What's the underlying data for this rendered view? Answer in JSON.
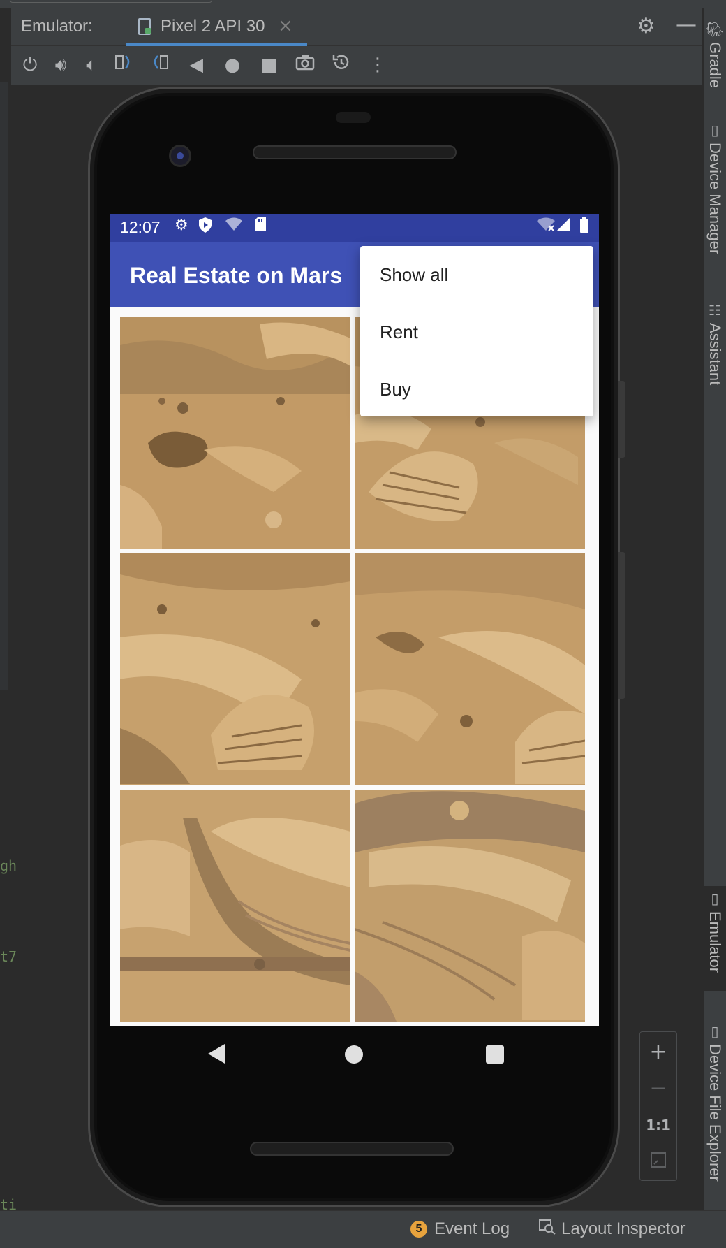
{
  "ide": {
    "emulator_label": "Emulator:",
    "device_tab": "Pixel 2 API 30",
    "tab_close": "×",
    "toolbar_icons": [
      "power-icon",
      "volume-up-icon",
      "volume-down-icon",
      "rotate-left-icon",
      "rotate-right-icon",
      "back-icon",
      "home-icon",
      "overview-icon",
      "screenshot-icon",
      "snapshot-icon",
      "more-icon"
    ],
    "right_tabs": {
      "gradle": "Gradle",
      "device_manager": "Device Manager",
      "assistant": "Assistant",
      "emulator": "Emulator",
      "device_file_explorer": "Device File Explorer"
    },
    "status": {
      "event_log_count": "5",
      "event_log": "Event Log",
      "layout_inspector": "Layout Inspector"
    },
    "zoom": {
      "plus": "+",
      "minus": "−",
      "one_to_one": "1:1"
    },
    "code_fragments": [
      "gh",
      "t7",
      "ti"
    ]
  },
  "device": {
    "status_time": "12:07",
    "app_title": "Real Estate on Mars",
    "menu_items": [
      "Show all",
      "Rent",
      "Buy"
    ]
  },
  "colors": {
    "status_bar": "#303f9f",
    "app_bar": "#3f51b5",
    "mars_sand": "#c4a06b"
  }
}
